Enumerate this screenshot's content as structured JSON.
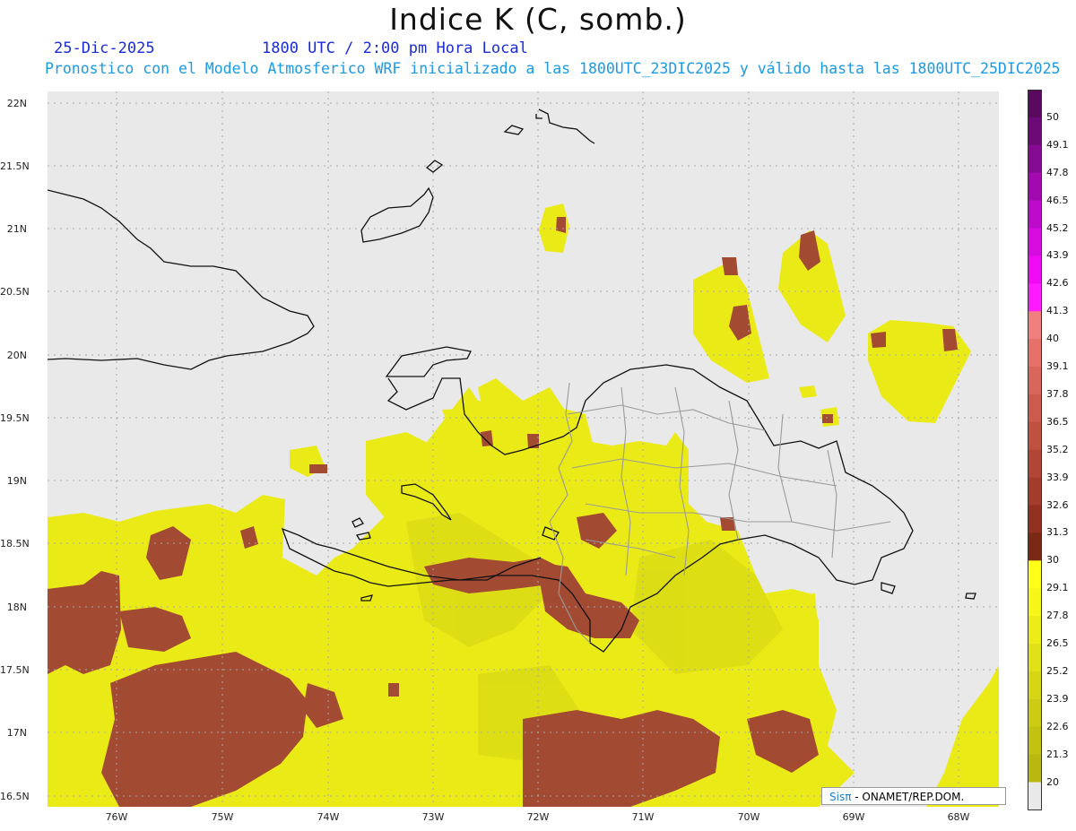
{
  "title": "Indice K (C, somb.)",
  "date": "25-Dic-2025",
  "time": "1800 UTC / 2:00 pm Hora Local",
  "description": "Pronostico con el Modelo Atmosferico WRF inicializado a las 1800UTC_23DIC2025 y válido hasta las  1800UTC_25DIC2025",
  "lat_labels": [
    "22N",
    "21.5N",
    "21N",
    "20.5N",
    "20N",
    "19.5N",
    "19N",
    "18.5N",
    "18N",
    "17.5N",
    "17N",
    "16.5N"
  ],
  "lon_labels": [
    "76W",
    "75W",
    "74W",
    "73W",
    "72W",
    "71W",
    "70W",
    "69W",
    "68W"
  ],
  "legend": {
    "labels": [
      "50",
      "49.1",
      "47.8",
      "46.5",
      "45.2",
      "43.9",
      "42.6",
      "41.3",
      "40",
      "39.1",
      "37.8",
      "36.5",
      "35.2",
      "33.9",
      "32.6",
      "31.3",
      "30",
      "29.1",
      "27.8",
      "26.5",
      "25.2",
      "23.9",
      "22.6",
      "21.3",
      "20"
    ],
    "colors": [
      "#5a0a5e",
      "#6e0a78",
      "#870a93",
      "#a20ab0",
      "#be0acb",
      "#d70ae0",
      "#ee0af2",
      "#ff1aff",
      "#f07f7f",
      "#e57169",
      "#d8665a",
      "#cc5b4d",
      "#bf5141",
      "#b14636",
      "#a33c2b",
      "#933120",
      "#7a2a14",
      "#ffff1a",
      "#f6f619",
      "#ecec18",
      "#e1e117",
      "#d6d615",
      "#cccc14",
      "#c2c212",
      "#b8b811"
    ]
  },
  "credit": {
    "sis": "Sisπ",
    "rest": " - ONAMET/REP.DOM."
  }
}
